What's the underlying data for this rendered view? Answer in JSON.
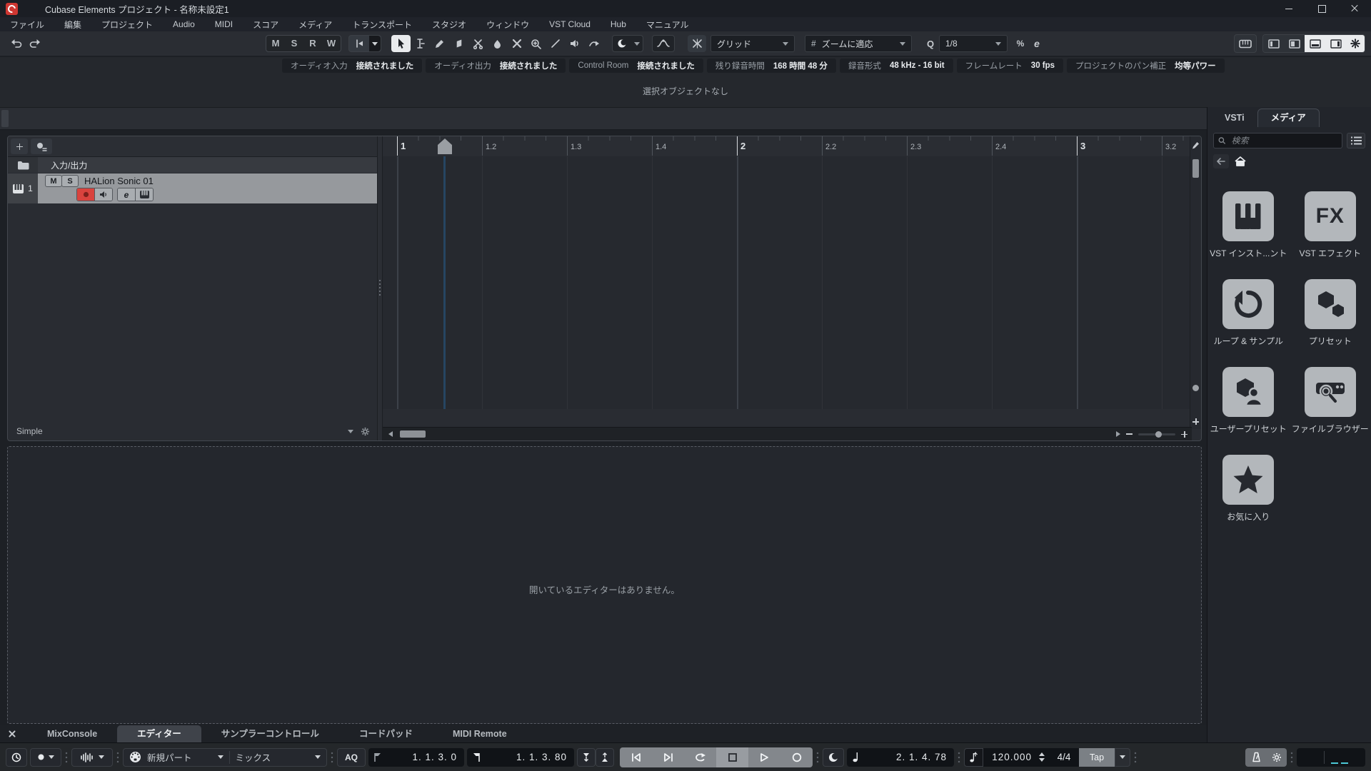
{
  "window": {
    "title": "Cubase Elements プロジェクト - 名称未設定1"
  },
  "menu": {
    "items": [
      "ファイル",
      "編集",
      "プロジェクト",
      "Audio",
      "MIDI",
      "スコア",
      "メディア",
      "トランスポート",
      "スタジオ",
      "ウィンドウ",
      "VST Cloud",
      "Hub",
      "マニュアル"
    ]
  },
  "toolbar": {
    "automation": {
      "m": "M",
      "s": "S",
      "r": "R",
      "w": "W"
    },
    "snap_mode": "グリッド",
    "grid_type": "ズームに適応",
    "hash_glyph": "#",
    "quantize_glyph": "Q",
    "quantize_value": "1/8",
    "iterative_quantize_glyph": "%",
    "quantize_panel_glyph": "e"
  },
  "status_items": [
    {
      "label": "オーディオ入力",
      "value": "接続されました"
    },
    {
      "label": "オーディオ出力",
      "value": "接続されました"
    },
    {
      "label": "Control Room",
      "value": "接続されました"
    },
    {
      "label": "残り録音時間",
      "value": "168 時間 48 分"
    },
    {
      "label": "録音形式",
      "value": "48 kHz - 16 bit"
    },
    {
      "label": "フレームレート",
      "value": "30 fps"
    },
    {
      "label": "プロジェクトのパン補正",
      "value": "均等パワー"
    }
  ],
  "info_line": "選択オブジェクトなし",
  "track_list": {
    "io_row_label": "入力/出力",
    "track": {
      "number": "1",
      "name": "HALion Sonic 01",
      "mute_glyph": "M",
      "solo_glyph": "S",
      "edit_glyph": "e"
    },
    "preset_name": "Simple"
  },
  "ruler": {
    "ticks": [
      {
        "label": "1",
        "major": true
      },
      {
        "label": "1.2",
        "major": false
      },
      {
        "label": "1.3",
        "major": false
      },
      {
        "label": "1.4",
        "major": false
      },
      {
        "label": "2",
        "major": true
      },
      {
        "label": "2.2",
        "major": false
      },
      {
        "label": "2.3",
        "major": false
      },
      {
        "label": "2.4",
        "major": false
      },
      {
        "label": "3",
        "major": true
      },
      {
        "label": "3.2",
        "major": false
      }
    ]
  },
  "lower_zone": {
    "empty_message": "開いているエディターはありません。",
    "tabs": [
      {
        "label": "MixConsole",
        "active": false
      },
      {
        "label": "エディター",
        "active": true
      },
      {
        "label": "サンプラーコントロール",
        "active": false
      },
      {
        "label": "コードパッド",
        "active": false
      },
      {
        "label": "MIDI Remote",
        "active": false
      }
    ]
  },
  "right_zone": {
    "tabs": [
      {
        "label": "VSTi",
        "active": false
      },
      {
        "label": "メディア",
        "active": true
      }
    ],
    "search_placeholder": "検索",
    "tiles": [
      {
        "icon": "piano-icon",
        "label": "VST インスト...ント"
      },
      {
        "icon": "fx-icon",
        "label": "VST エフェクト",
        "icon_text": "FX"
      },
      {
        "icon": "loop-icon",
        "label": "ループ & サンプル"
      },
      {
        "icon": "hexagons-icon",
        "label": "プリセット"
      },
      {
        "icon": "user-preset-icon",
        "label": "ユーザープリセット"
      },
      {
        "icon": "file-browser-icon",
        "label": "ファイルブラウザー"
      },
      {
        "icon": "star-icon",
        "label": "お気に入り"
      }
    ]
  },
  "transport": {
    "midi_record_mode": "新規パート",
    "midi_mix_mode": "ミックス",
    "auto_quantize_label": "AQ",
    "left_locator": "1. 1. 3.  0",
    "right_locator": "1. 1. 3. 80",
    "secondary_time": "2. 1. 4. 78",
    "tempo": "120.000",
    "time_signature": "4/4",
    "tap_label": "Tap"
  },
  "colors": {
    "accent_red": "#d9433e",
    "cyan_activity": "#4cc8d6",
    "selected_track": "#96999d",
    "tile_bg": "#b3b7bb"
  }
}
